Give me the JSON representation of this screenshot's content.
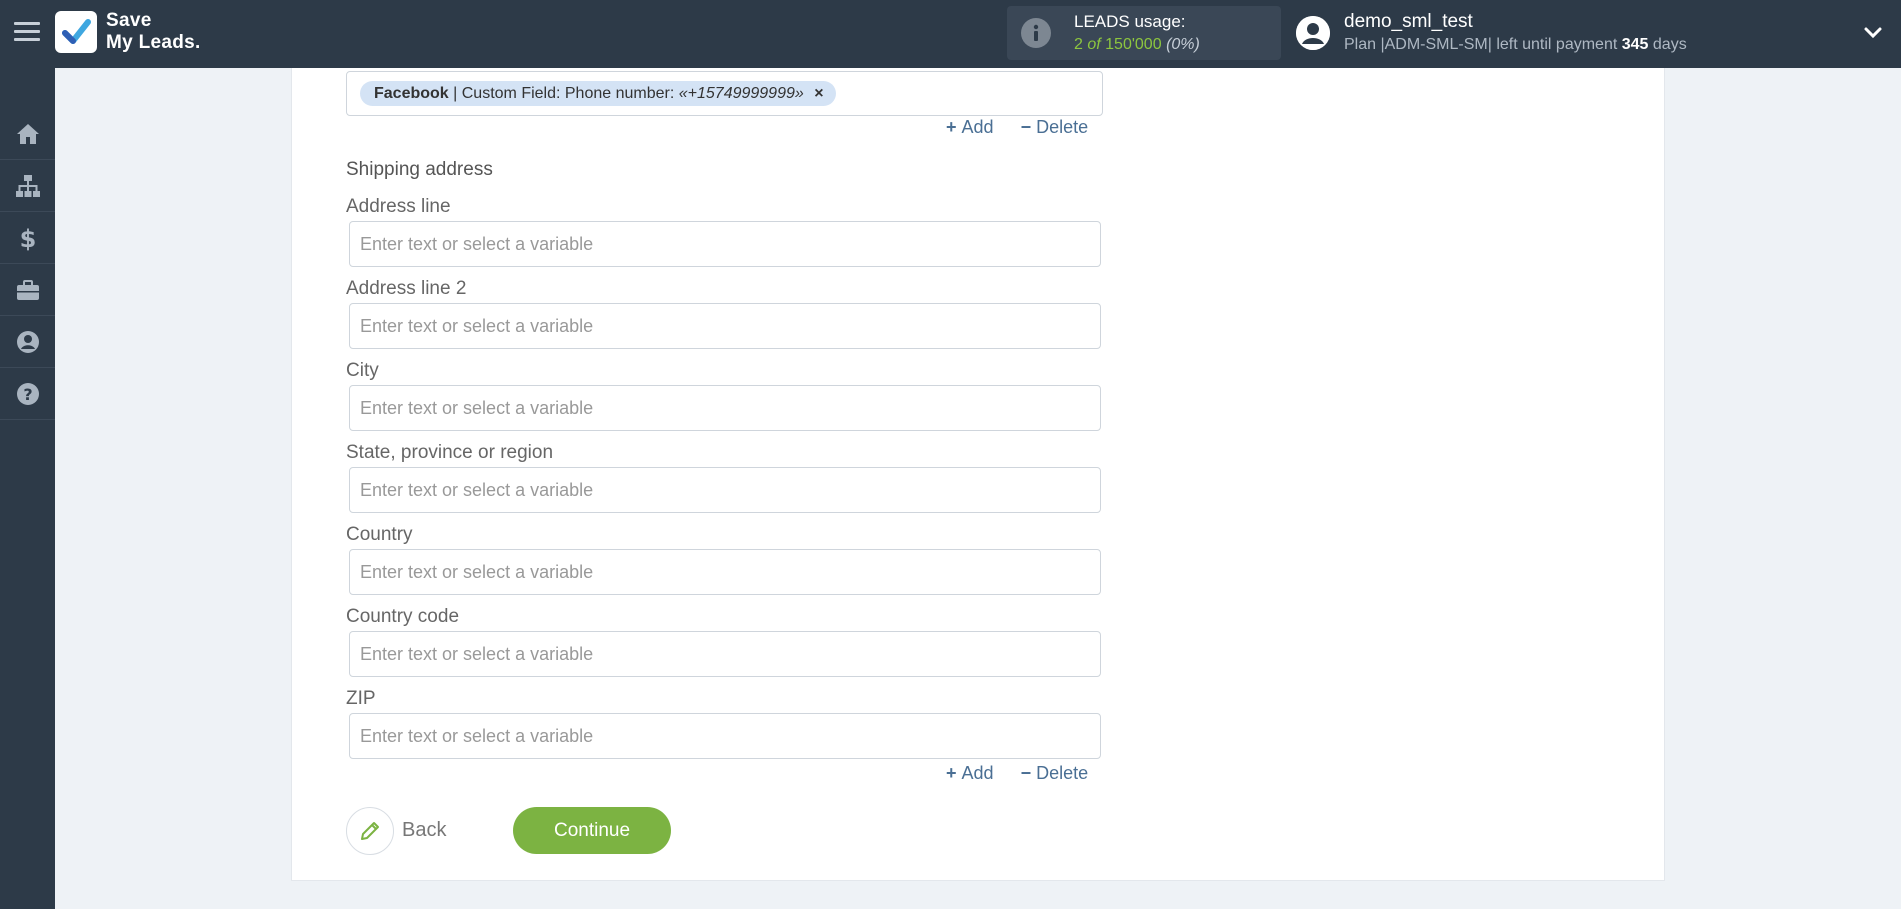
{
  "header": {
    "logo_line1": "Save",
    "logo_line2": "My Leads.",
    "usage_title": "LEADS usage:",
    "usage_used": "2",
    "usage_of": "of",
    "usage_total": "150'000",
    "usage_percent": "(0%)",
    "user_name": "demo_sml_test",
    "plan_prefix": "Plan |ADM-SML-SM| left until payment",
    "plan_days": "345",
    "plan_suffix": "days"
  },
  "sidebar": {
    "items": [
      "home-icon",
      "sitemap-icon",
      "dollar-icon",
      "briefcase-icon",
      "user-icon",
      "help-icon"
    ]
  },
  "phone_field": {
    "tag_source": "Facebook",
    "tag_text": "| Custom Field: Phone number:",
    "tag_value": "«+15749999999»",
    "tag_remove": "×"
  },
  "actions": {
    "add_symbol": "+",
    "add_label": "Add",
    "delete_symbol": "−",
    "delete_label": "Delete"
  },
  "shipping": {
    "title": "Shipping address",
    "placeholder": "Enter text or select a variable",
    "fields": [
      {
        "label": "Address line",
        "value": ""
      },
      {
        "label": "Address line 2",
        "value": ""
      },
      {
        "label": "City",
        "value": ""
      },
      {
        "label": "State, province or region",
        "value": ""
      },
      {
        "label": "Country",
        "value": ""
      },
      {
        "label": "Country code",
        "value": ""
      },
      {
        "label": "ZIP",
        "value": ""
      }
    ]
  },
  "footer": {
    "back_label": "Back",
    "continue_label": "Continue"
  },
  "colors": {
    "topbar": "#2d3a48",
    "accent_green": "#7cb342",
    "link_blue": "#4a6f94",
    "tag_bg": "#d4e3f5"
  }
}
